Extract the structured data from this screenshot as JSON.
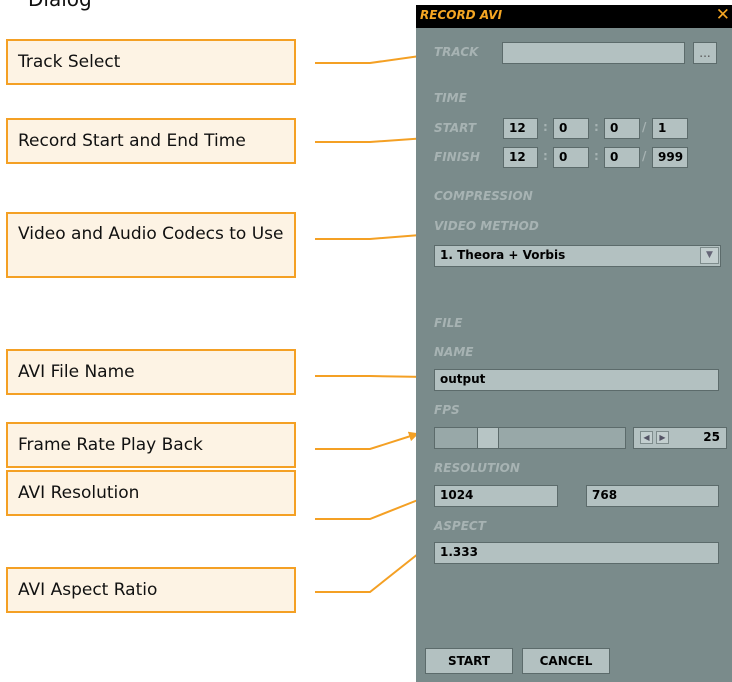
{
  "figure_caption_fragment": "Dialog",
  "callouts": {
    "track_select": "Track Select",
    "record_time": "Record Start and End Time",
    "codecs": "Video and Audio Codecs to Use",
    "file_name": "AVI File Name",
    "frame_rate": "Frame Rate Play Back",
    "resolution": "AVI Resolution",
    "aspect": "AVI Aspect Ratio"
  },
  "dialog": {
    "title": "RECORD AVI",
    "close_glyph": "✕",
    "track": {
      "label": "TRACK",
      "value": "",
      "browse_label": "..."
    },
    "time": {
      "section_label": "TIME",
      "start": {
        "label": "START",
        "h": "12",
        "m": "0",
        "s": "0",
        "frame": "1"
      },
      "finish": {
        "label": "FINISH",
        "h": "12",
        "m": "0",
        "s": "0",
        "frame": "999"
      },
      "sep_colon": ":",
      "sep_slash": "/"
    },
    "compression": {
      "section_label": "COMPRESSION",
      "method_label": "VIDEO METHOD",
      "method_value": "1. Theora + Vorbis"
    },
    "file": {
      "section_label": "FILE",
      "name_label": "NAME",
      "name_value": "output",
      "fps_label": "FPS",
      "fps_value": "25",
      "fps_slider_level": 0.25,
      "resolution_label": "RESOLUTION",
      "width_value": "1024",
      "height_value": "768",
      "aspect_label": "ASPECT",
      "aspect_value": "1.333"
    },
    "buttons": {
      "start": "START",
      "cancel": "CANCEL"
    }
  },
  "colors": {
    "accent": "#f5a623",
    "callout_border": "#f4a024",
    "callout_fill": "#fdf3e4",
    "dialog_bg": "#7a8b8b",
    "field_bg": "#b3c1c1",
    "muted_label": "#a7b3b3"
  },
  "icons": {
    "close": "close-icon",
    "dropdown": "chevron-down-icon",
    "spin_left": "arrow-left-icon",
    "spin_right": "arrow-right-icon"
  }
}
